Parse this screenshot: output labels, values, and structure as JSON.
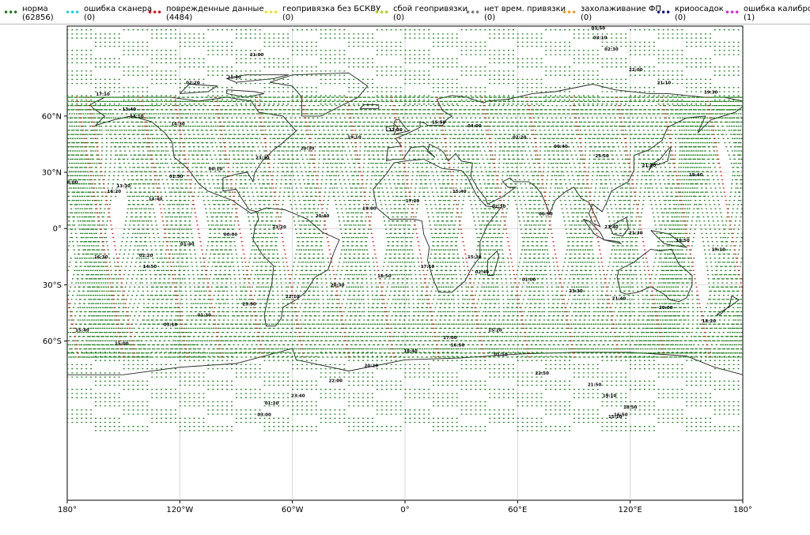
{
  "legend": {
    "items": [
      {
        "label": "норма",
        "count": "(62856)",
        "color": "#1a7f1a"
      },
      {
        "label": "ошибка сканера",
        "count": "(0)",
        "color": "#22d3e6"
      },
      {
        "label": "поврежденные данные",
        "count": "(4484)",
        "color": "#e01010"
      },
      {
        "label": "геопривязка без БСКВУ",
        "count": "(0)",
        "color": "#e8e81a"
      },
      {
        "label": "сбой геопривязки",
        "count": "(0)",
        "color": "#a6d61a"
      },
      {
        "label": "нет врем. привязки",
        "count": "(0)",
        "color": "#7a7a7a"
      },
      {
        "label": "захолаживание ФП",
        "count": "(0)",
        "color": "#f0a020"
      },
      {
        "label": "криоосадок",
        "count": "(0)",
        "color": "#101090"
      },
      {
        "label": "ошибка калибровки",
        "count": "(1)",
        "color": "#e020e0"
      }
    ]
  },
  "axes": {
    "lon_ticks": [
      "180°",
      "120°W",
      "60°W",
      "0°",
      "60°E",
      "120°E",
      "180°"
    ],
    "lat_ticks": [
      "60°N",
      "30°N",
      "0°",
      "30°S",
      "60°S"
    ]
  },
  "swaths": [
    {
      "time": "18:00",
      "lon": -178,
      "lat": 24
    },
    {
      "time": "17:10",
      "lon": -161,
      "lat": 71
    },
    {
      "time": "16:20",
      "lon": -155,
      "lat": 19
    },
    {
      "time": "16:30",
      "lon": -162,
      "lat": -16
    },
    {
      "time": "15:40",
      "lon": -172,
      "lat": -55
    },
    {
      "time": "15:00",
      "lon": -151,
      "lat": -62
    },
    {
      "time": "14:50",
      "lon": -136,
      "lat": -21
    },
    {
      "time": "14:40",
      "lon": -133,
      "lat": 15
    },
    {
      "time": "14:30",
      "lon": -121,
      "lat": 55
    },
    {
      "time": "14:10",
      "lon": -143,
      "lat": 59
    },
    {
      "time": "13:40",
      "lon": -147,
      "lat": 63
    },
    {
      "time": "13:30",
      "lon": -150,
      "lat": 22
    },
    {
      "time": "02:20",
      "lon": -138,
      "lat": -15
    },
    {
      "time": "01:50",
      "lon": -122,
      "lat": 27
    },
    {
      "time": "01:40",
      "lon": -116,
      "lat": -9
    },
    {
      "time": "01:30",
      "lon": -107,
      "lat": -47
    },
    {
      "time": "03:10",
      "lon": -125,
      "lat": -52
    },
    {
      "time": "02:20",
      "lon": -113,
      "lat": 77
    },
    {
      "time": "00:10",
      "lon": -101,
      "lat": 31
    },
    {
      "time": "00:00",
      "lon": -93,
      "lat": -4
    },
    {
      "time": "23:50",
      "lon": -83,
      "lat": -41
    },
    {
      "time": "23:30",
      "lon": -76,
      "lat": 37
    },
    {
      "time": "23:20",
      "lon": -67,
      "lat": 0
    },
    {
      "time": "22:10",
      "lon": -60,
      "lat": -37
    },
    {
      "time": "21:40",
      "lon": -91,
      "lat": 80
    },
    {
      "time": "21:00",
      "lon": -79,
      "lat": 92
    },
    {
      "time": "20:30",
      "lon": -52,
      "lat": 42
    },
    {
      "time": "20:40",
      "lon": -44,
      "lat": 6
    },
    {
      "time": "20:30",
      "lon": -36,
      "lat": -31
    },
    {
      "time": "20:20",
      "lon": -18,
      "lat": -74
    },
    {
      "time": "19:10",
      "lon": -27,
      "lat": 48
    },
    {
      "time": "19:00",
      "lon": -19,
      "lat": 10
    },
    {
      "time": "18:50",
      "lon": -11,
      "lat": -26
    },
    {
      "time": "18:40",
      "lon": 3,
      "lat": -66
    },
    {
      "time": "17:30",
      "lon": -5,
      "lat": 52
    },
    {
      "time": "17:20",
      "lon": 4,
      "lat": 14
    },
    {
      "time": "17:10",
      "lon": 12,
      "lat": -21
    },
    {
      "time": "17:00",
      "lon": 24,
      "lat": -59
    },
    {
      "time": "16:50",
      "lon": 28,
      "lat": -63
    },
    {
      "time": "15:50",
      "lon": 18,
      "lat": 56
    },
    {
      "time": "15:40",
      "lon": 29,
      "lat": 19
    },
    {
      "time": "15:30",
      "lon": 37,
      "lat": -16
    },
    {
      "time": "15:20",
      "lon": 48,
      "lat": -55
    },
    {
      "time": "02:40",
      "lon": 41,
      "lat": -24
    },
    {
      "time": "04:00",
      "lon": 37,
      "lat": 54
    },
    {
      "time": "02:20",
      "lon": 61,
      "lat": 48
    },
    {
      "time": "02:30",
      "lon": 50,
      "lat": 11
    },
    {
      "time": "01:10",
      "lon": 51,
      "lat": -68
    },
    {
      "time": "01:00",
      "lon": 66,
      "lat": -28
    },
    {
      "time": "00:50",
      "lon": 75,
      "lat": 7
    },
    {
      "time": "00:40",
      "lon": 83,
      "lat": 43
    },
    {
      "time": "03:50",
      "lon": 103,
      "lat": 106
    },
    {
      "time": "03:10",
      "lon": 104,
      "lat": 101
    },
    {
      "time": "02:30",
      "lon": 110,
      "lat": 95
    },
    {
      "time": "23:50",
      "lon": 105,
      "lat": 38
    },
    {
      "time": "23:40",
      "lon": 110,
      "lat": 0
    },
    {
      "time": "23:30",
      "lon": 91,
      "lat": -34
    },
    {
      "time": "22:50",
      "lon": 73,
      "lat": -78
    },
    {
      "time": "21:50",
      "lon": 101,
      "lat": -84
    },
    {
      "time": "21:40",
      "lon": 114,
      "lat": -38
    },
    {
      "time": "21:30",
      "lon": 123,
      "lat": -3
    },
    {
      "time": "21:20",
      "lon": 130,
      "lat": 33
    },
    {
      "time": "21:10",
      "lon": 138,
      "lat": 77
    },
    {
      "time": "22:00",
      "lon": 123,
      "lat": 84
    },
    {
      "time": "20:00",
      "lon": 139,
      "lat": -43
    },
    {
      "time": "19:50",
      "lon": 148,
      "lat": -7
    },
    {
      "time": "19:40",
      "lon": 155,
      "lat": 28
    },
    {
      "time": "19:30",
      "lon": 163,
      "lat": 72
    },
    {
      "time": "19:10",
      "lon": 167,
      "lat": -12
    },
    {
      "time": "18:20",
      "lon": 162,
      "lat": -50
    },
    {
      "time": "19:10",
      "lon": 109,
      "lat": -90
    },
    {
      "time": "18:50",
      "lon": 120,
      "lat": -96
    },
    {
      "time": "16:50",
      "lon": 115,
      "lat": -100
    },
    {
      "time": "15:10",
      "lon": 112,
      "lat": -101
    },
    {
      "time": "01:20",
      "lon": -71,
      "lat": -94
    },
    {
      "time": "03:00",
      "lon": -75,
      "lat": -100
    },
    {
      "time": "23:40",
      "lon": -57,
      "lat": -90
    },
    {
      "time": "22:00",
      "lon": -37,
      "lat": -82
    }
  ]
}
